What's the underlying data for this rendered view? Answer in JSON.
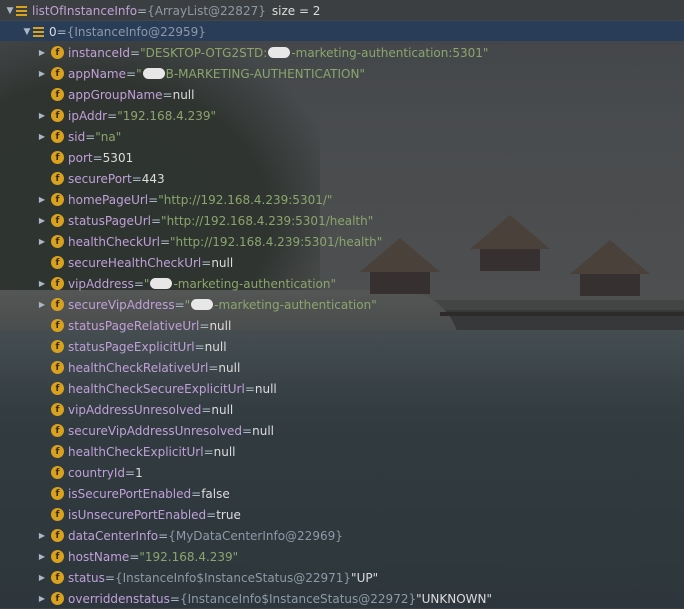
{
  "root": {
    "name": "listOfInstanceInfo",
    "ref": "{ArrayList@22827}",
    "extra": "size = 2"
  },
  "item0": {
    "name": "0",
    "ref": "{InstanceInfo@22959}"
  },
  "fields": [
    {
      "name": "instanceId",
      "value_pre": "\"DESKTOP-OTG2STD:",
      "value_post": "-marketing-authentication:5301\"",
      "redacted": true,
      "kind": "str",
      "expandable": true
    },
    {
      "name": "appName",
      "value_pre": "\"",
      "value_post": "B-MARKETING-AUTHENTICATION\"",
      "redacted": true,
      "kind": "str",
      "expandable": true
    },
    {
      "name": "appGroupName",
      "value_pre": "null",
      "value_post": "",
      "redacted": false,
      "kind": "plain",
      "expandable": false
    },
    {
      "name": "ipAddr",
      "value_pre": "\"192.168.4.239\"",
      "value_post": "",
      "redacted": false,
      "kind": "str",
      "expandable": true
    },
    {
      "name": "sid",
      "value_pre": "\"na\"",
      "value_post": "",
      "redacted": false,
      "kind": "str",
      "expandable": true
    },
    {
      "name": "port",
      "value_pre": "5301",
      "value_post": "",
      "redacted": false,
      "kind": "plain",
      "expandable": false
    },
    {
      "name": "securePort",
      "value_pre": "443",
      "value_post": "",
      "redacted": false,
      "kind": "plain",
      "expandable": false
    },
    {
      "name": "homePageUrl",
      "value_pre": "\"http://192.168.4.239:5301/\"",
      "value_post": "",
      "redacted": false,
      "kind": "str",
      "expandable": true
    },
    {
      "name": "statusPageUrl",
      "value_pre": "\"http://192.168.4.239:5301/health\"",
      "value_post": "",
      "redacted": false,
      "kind": "str",
      "expandable": true
    },
    {
      "name": "healthCheckUrl",
      "value_pre": "\"http://192.168.4.239:5301/health\"",
      "value_post": "",
      "redacted": false,
      "kind": "str",
      "expandable": true
    },
    {
      "name": "secureHealthCheckUrl",
      "value_pre": "null",
      "value_post": "",
      "redacted": false,
      "kind": "plain",
      "expandable": false
    },
    {
      "name": "vipAddress",
      "value_pre": "\"",
      "value_post": "-marketing-authentication\"",
      "redacted": true,
      "kind": "str",
      "expandable": true
    },
    {
      "name": "secureVipAddress",
      "value_pre": "\"",
      "value_post": "-marketing-authentication\"",
      "redacted": true,
      "kind": "str",
      "expandable": true
    },
    {
      "name": "statusPageRelativeUrl",
      "value_pre": "null",
      "value_post": "",
      "redacted": false,
      "kind": "plain",
      "expandable": false
    },
    {
      "name": "statusPageExplicitUrl",
      "value_pre": "null",
      "value_post": "",
      "redacted": false,
      "kind": "plain",
      "expandable": false
    },
    {
      "name": "healthCheckRelativeUrl",
      "value_pre": "null",
      "value_post": "",
      "redacted": false,
      "kind": "plain",
      "expandable": false
    },
    {
      "name": "healthCheckSecureExplicitUrl",
      "value_pre": "null",
      "value_post": "",
      "redacted": false,
      "kind": "plain",
      "expandable": false
    },
    {
      "name": "vipAddressUnresolved",
      "value_pre": "null",
      "value_post": "",
      "redacted": false,
      "kind": "plain",
      "expandable": false
    },
    {
      "name": "secureVipAddressUnresolved",
      "value_pre": "null",
      "value_post": "",
      "redacted": false,
      "kind": "plain",
      "expandable": false
    },
    {
      "name": "healthCheckExplicitUrl",
      "value_pre": "null",
      "value_post": "",
      "redacted": false,
      "kind": "plain",
      "expandable": false
    },
    {
      "name": "countryId",
      "value_pre": "1",
      "value_post": "",
      "redacted": false,
      "kind": "plain",
      "expandable": false
    },
    {
      "name": "isSecurePortEnabled",
      "value_pre": "false",
      "value_post": "",
      "redacted": false,
      "kind": "plain",
      "expandable": false
    },
    {
      "name": "isUnsecurePortEnabled",
      "value_pre": "true",
      "value_post": "",
      "redacted": false,
      "kind": "plain",
      "expandable": false
    },
    {
      "name": "dataCenterInfo",
      "value_pre": "{MyDataCenterInfo@22969}",
      "value_post": "",
      "redacted": false,
      "kind": "ref",
      "expandable": true
    },
    {
      "name": "hostName",
      "value_pre": "\"192.168.4.239\"",
      "value_post": "",
      "redacted": false,
      "kind": "str",
      "expandable": true
    },
    {
      "name": "status",
      "value_pre": "{InstanceInfo$InstanceStatus@22971}",
      "value_post": " \"UP\"",
      "redacted": false,
      "kind": "ref",
      "expandable": true
    },
    {
      "name": "overriddenstatus",
      "value_pre": "{InstanceInfo$InstanceStatus@22972}",
      "value_post": " \"UNKNOWN\"",
      "redacted": false,
      "kind": "ref",
      "expandable": true
    }
  ],
  "symbols": {
    "eq": " = ",
    "field_badge": "f",
    "arrow_expanded": "▼",
    "arrow_collapsed": "▶"
  },
  "colors": {
    "field_name": "#c0a0d8",
    "string_value": "#8aa66c",
    "ref_value": "#8d9aa5",
    "plain_value": "#dcdcdc",
    "field_badge": "#d8a21f",
    "selected_row": "#2a3d58"
  }
}
